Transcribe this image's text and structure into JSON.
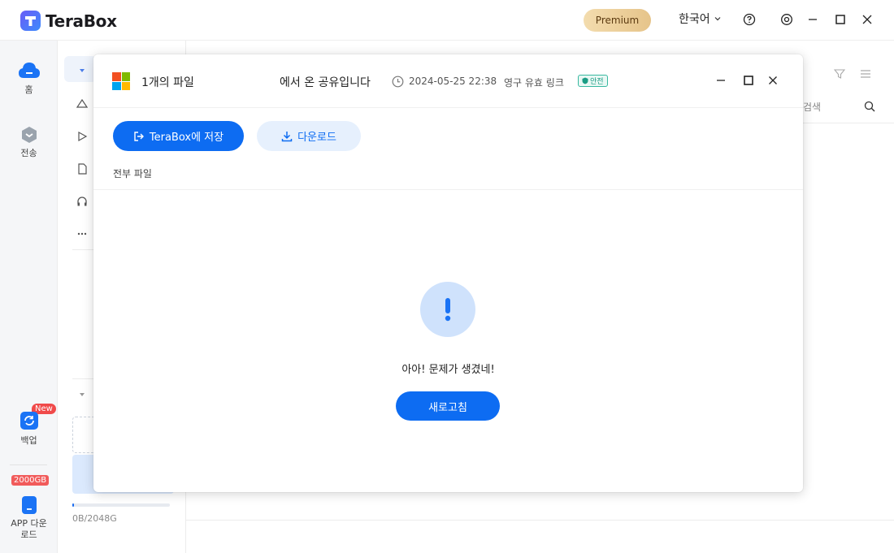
{
  "app": {
    "name": "TeraBox",
    "premium_label": "Premium",
    "language": "한국어"
  },
  "rail": {
    "home_label": "홈",
    "transfer_label": "전송",
    "backup_label": "백업",
    "new_badge": "New",
    "storage_badge": "2000GB",
    "app_download_label": "APP 다운로드"
  },
  "sidebar": {
    "storage_used": "0B/2048G",
    "storage_used_fraction": 0.0
  },
  "main": {
    "search_placeholder": "검색"
  },
  "dialog": {
    "file_count": "1개의 파일",
    "share_from": "에서 온 공유입니다",
    "date": "2024-05-25 22:38",
    "link_type": "영구 유효 링크",
    "safe_badge": "안전",
    "save_button": "TeraBox에 저장",
    "download_button": "다운로드",
    "breadcrumb": "전부 파일",
    "error_message": "아아! 문제가 생겼네!",
    "refresh_button": "새로고침"
  },
  "colors": {
    "accent": "#0d6cf2",
    "accent_light": "#e6f0fd",
    "error_circle": "#cfe2fc",
    "badge_red": "#f04a4a",
    "premium_gold": "#e6c48a"
  }
}
